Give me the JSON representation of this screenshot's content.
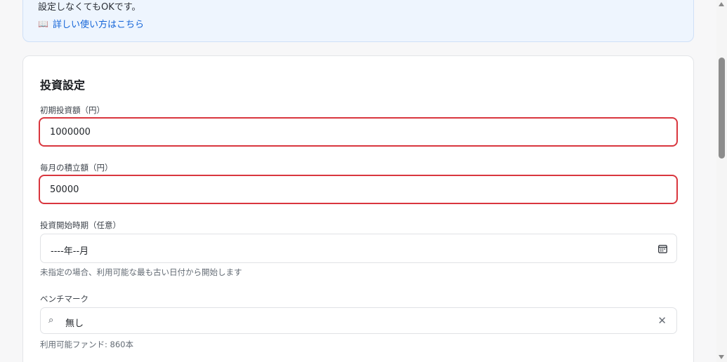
{
  "info": {
    "text": "設定しなくてもOKです。",
    "link_icon": "📖",
    "link_label": "詳しい使い方はこちら"
  },
  "settings": {
    "title": "投資設定",
    "initial": {
      "label": "初期投資額（円）",
      "value": "1000000"
    },
    "monthly": {
      "label": "毎月の積立額（円）",
      "value": "50000"
    },
    "start": {
      "label": "投資開始時期（任意）",
      "value": "----年--月",
      "help": "未指定の場合、利用可能な最も古い日付から開始します"
    },
    "benchmark": {
      "label": "ベンチマーク",
      "search_glyph": "⌕",
      "value": "無し",
      "clear_glyph": "✕",
      "help": "利用可能ファンド: 860本"
    }
  },
  "colors": {
    "error_border": "#d9363e",
    "link": "#1565d8",
    "info_bg": "#eef5fe"
  }
}
